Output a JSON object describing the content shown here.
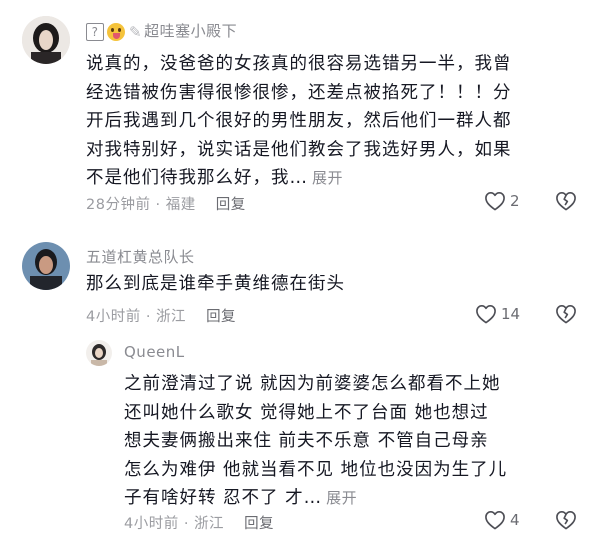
{
  "comments": [
    {
      "username": "超哇塞小殿下",
      "badge_box": "?",
      "lines": [
        "说真的，没爸爸的女孩真的很容易选错另一半，我曾",
        "经选错被伤害得很惨很惨，还差点被掐死了！！！分",
        "开后我遇到几个很好的男性朋友，然后他们一群人都",
        "对我特别好，说实话是他们教会了我选好男人，如果",
        "不是他们待我那么好，我…"
      ],
      "expand_label": "展开",
      "time": "28分钟前",
      "location": "福建",
      "reply_label": "回复",
      "likes": "2"
    },
    {
      "username": "五道杠黄总队长",
      "lines": [
        "那么到底是谁牵手黄维德在街头"
      ],
      "time": "4小时前",
      "location": "浙江",
      "reply_label": "回复",
      "likes": "14"
    },
    {
      "username": "QueenL",
      "lines": [
        "之前澄清过了说 就因为前婆婆怎么都看不上她",
        "还叫她什么歌女  觉得她上不了台面 她也想过",
        "想夫妻俩搬出来住  前夫不乐意  不管自己母亲",
        "怎么为难伊  他就当看不见 地位也没因为生了儿",
        "子有啥好转 忍不了  才…"
      ],
      "expand_label": "展开",
      "time": "4小时前",
      "location": "浙江",
      "reply_label": "回复",
      "likes": "4"
    }
  ],
  "meta_separator": " · ",
  "icons": {
    "like": "heart-outline-icon",
    "dislike": "broken-heart-icon"
  }
}
